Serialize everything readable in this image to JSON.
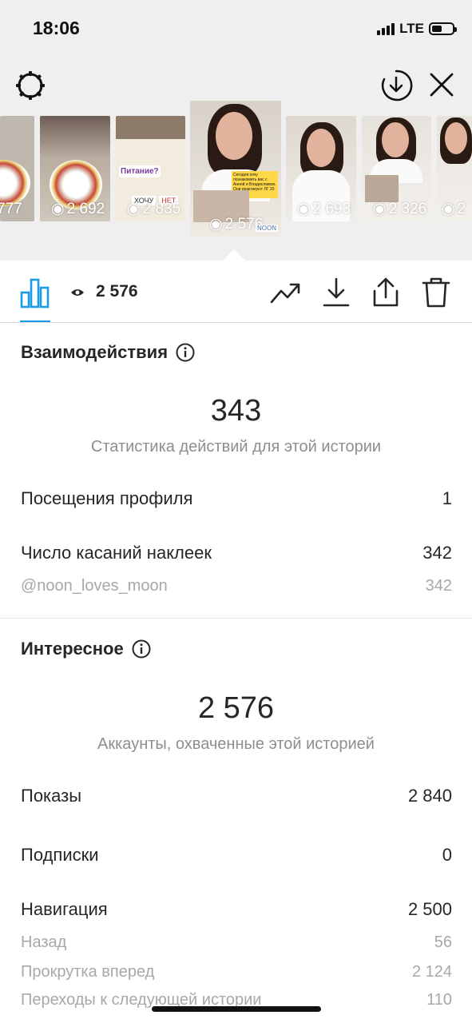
{
  "status_bar": {
    "time": "18:06",
    "network": "LTE"
  },
  "stories": [
    {
      "views": "777"
    },
    {
      "views": "2 692"
    },
    {
      "views": "2 835"
    },
    {
      "views": "2 576",
      "selected": true
    },
    {
      "views": "2 693"
    },
    {
      "views": "2 326"
    },
    {
      "views": "2"
    }
  ],
  "story_stickers": {
    "s3_text": "Питание?",
    "s3_poll_yes": "ХОЧУ",
    "s3_poll_no": "НЕТ",
    "sel_text": "Сегодня хочу познакомить вас с Анной и Владиславом. Они практикуют ЛГ 20 лет!",
    "sel_tag": "NOON"
  },
  "toolbar": {
    "view_count": "2 576"
  },
  "interactions": {
    "title": "Взаимодействия",
    "total": "343",
    "subtitle": "Статистика действий для этой истории",
    "rows": [
      {
        "label": "Посещения профиля",
        "value": "1"
      },
      {
        "label": "Число касаний наклеек",
        "value": "342"
      }
    ],
    "sub_rows": [
      {
        "label": "@noon_loves_moon",
        "value": "342"
      }
    ]
  },
  "discovery": {
    "title": "Интересное",
    "total": "2 576",
    "subtitle": "Аккаунты, охваченные этой историей",
    "rows": [
      {
        "label": "Показы",
        "value": "2 840"
      },
      {
        "label": "Подписки",
        "value": "0"
      },
      {
        "label": "Навигация",
        "value": "2 500"
      }
    ],
    "sub_rows": [
      {
        "label": "Назад",
        "value": "56"
      },
      {
        "label": "Прокрутка вперед",
        "value": "2 124"
      },
      {
        "label": "Переходы к следующей истории",
        "value": "110"
      }
    ]
  },
  "colors": {
    "accent": "#1a9be6",
    "background_top": "#efefef",
    "muted_text": "#8e8e8e"
  }
}
